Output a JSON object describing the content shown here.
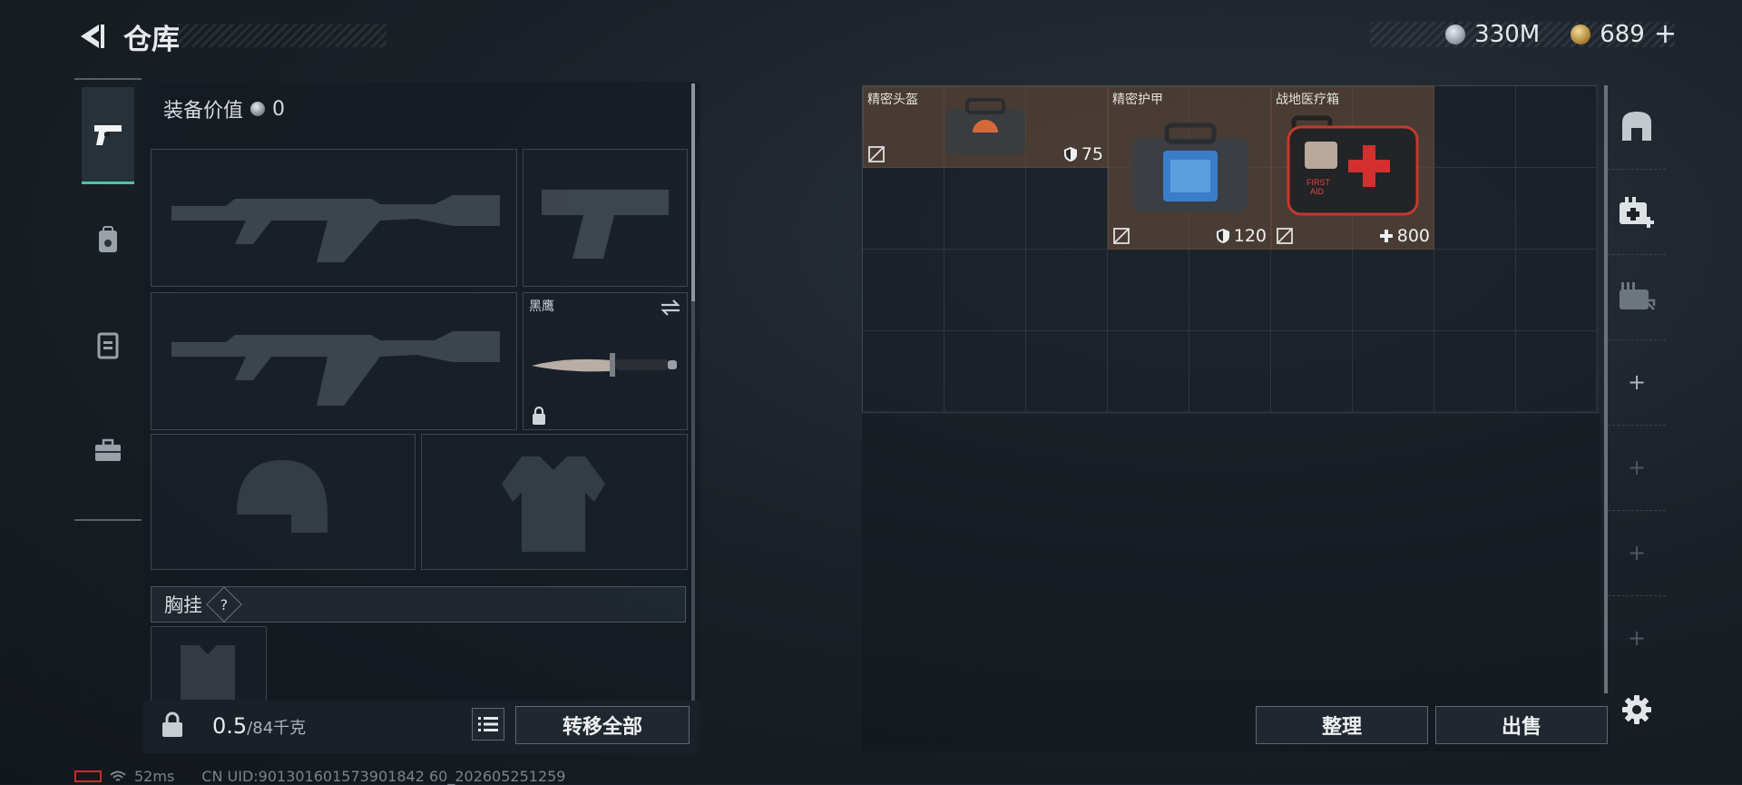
{
  "header": {
    "title": "仓库",
    "currency_1": "330M",
    "currency_2": "689",
    "add_symbol": "+"
  },
  "tabs": [
    {
      "icon": "pistol-icon",
      "active": true
    },
    {
      "icon": "backpack-icon",
      "active": false
    },
    {
      "icon": "vest-icon",
      "active": false
    },
    {
      "icon": "toolbox-icon",
      "active": false
    }
  ],
  "loadout": {
    "equipment_value_label": "装备价值",
    "equipment_value": "0",
    "melee_name": "黑鹰",
    "chest_rig_label": "胸挂",
    "help_mark": "?",
    "weight_current": "0.5",
    "weight_max": "/84千克",
    "transfer_all": "转移全部"
  },
  "storage": {
    "items": [
      {
        "name": "精密头盔",
        "stat": "75",
        "stat_icon": "shield-icon"
      },
      {
        "name": "精密护甲",
        "stat": "120",
        "stat_icon": "shield-icon"
      },
      {
        "name": "战地医疗箱",
        "stat": "800",
        "stat_icon": "plus-icon"
      }
    ],
    "sort_label": "整理",
    "sell_label": "出售"
  },
  "right_toolbar": [
    {
      "icon": "safe-icon"
    },
    {
      "icon": "medkit-add-icon"
    },
    {
      "icon": "ammo-box-icon"
    },
    {
      "icon": "plus-icon"
    },
    {
      "icon": "plus-icon"
    },
    {
      "icon": "plus-icon"
    },
    {
      "icon": "plus-icon"
    },
    {
      "icon": "settings-icon"
    }
  ],
  "status": {
    "ping": "52ms",
    "uid": "CN UID:901301601573901842 60_202605251259"
  },
  "colors": {
    "accent": "#4fc2a6",
    "item_bg": "#6e523e",
    "panel": "#1a2028"
  }
}
